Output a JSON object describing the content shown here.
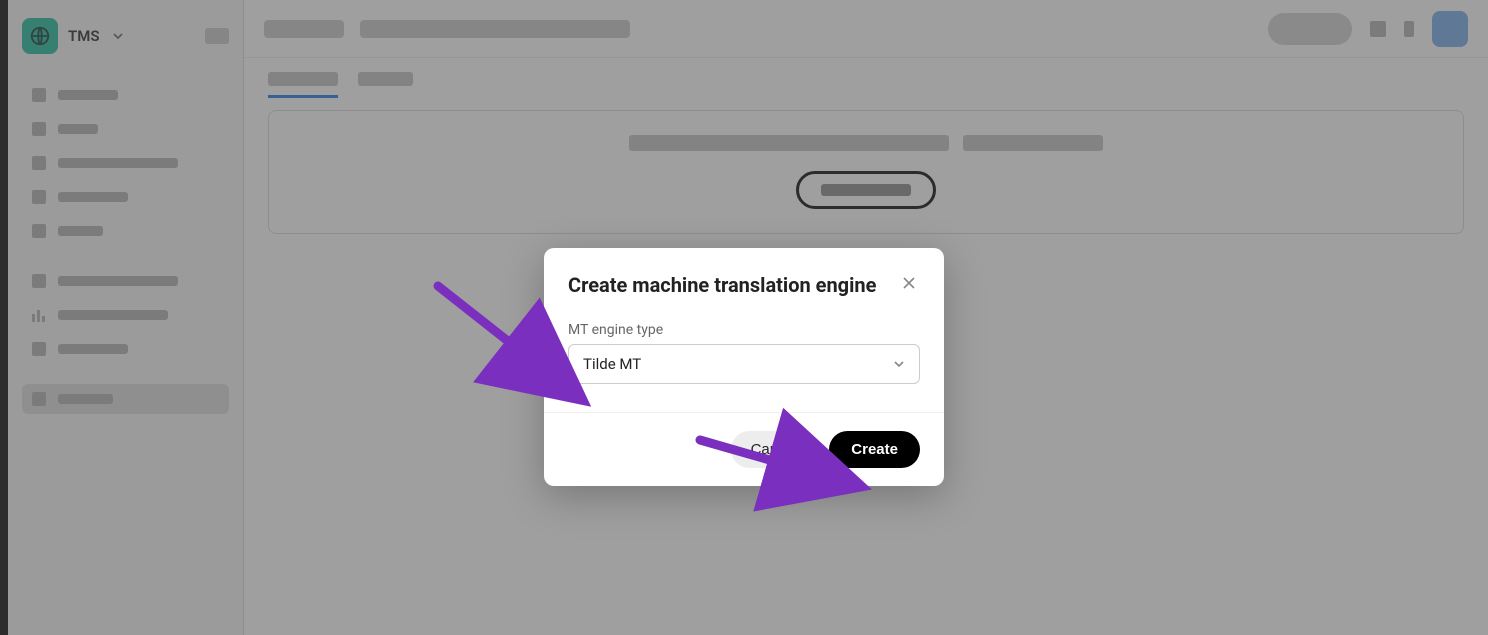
{
  "brand": {
    "label": "TMS"
  },
  "modal": {
    "title": "Create machine translation engine",
    "field_label": "MT engine type",
    "selected_value": "Tilde MT",
    "cancel_label": "Cancel",
    "create_label": "Create"
  }
}
